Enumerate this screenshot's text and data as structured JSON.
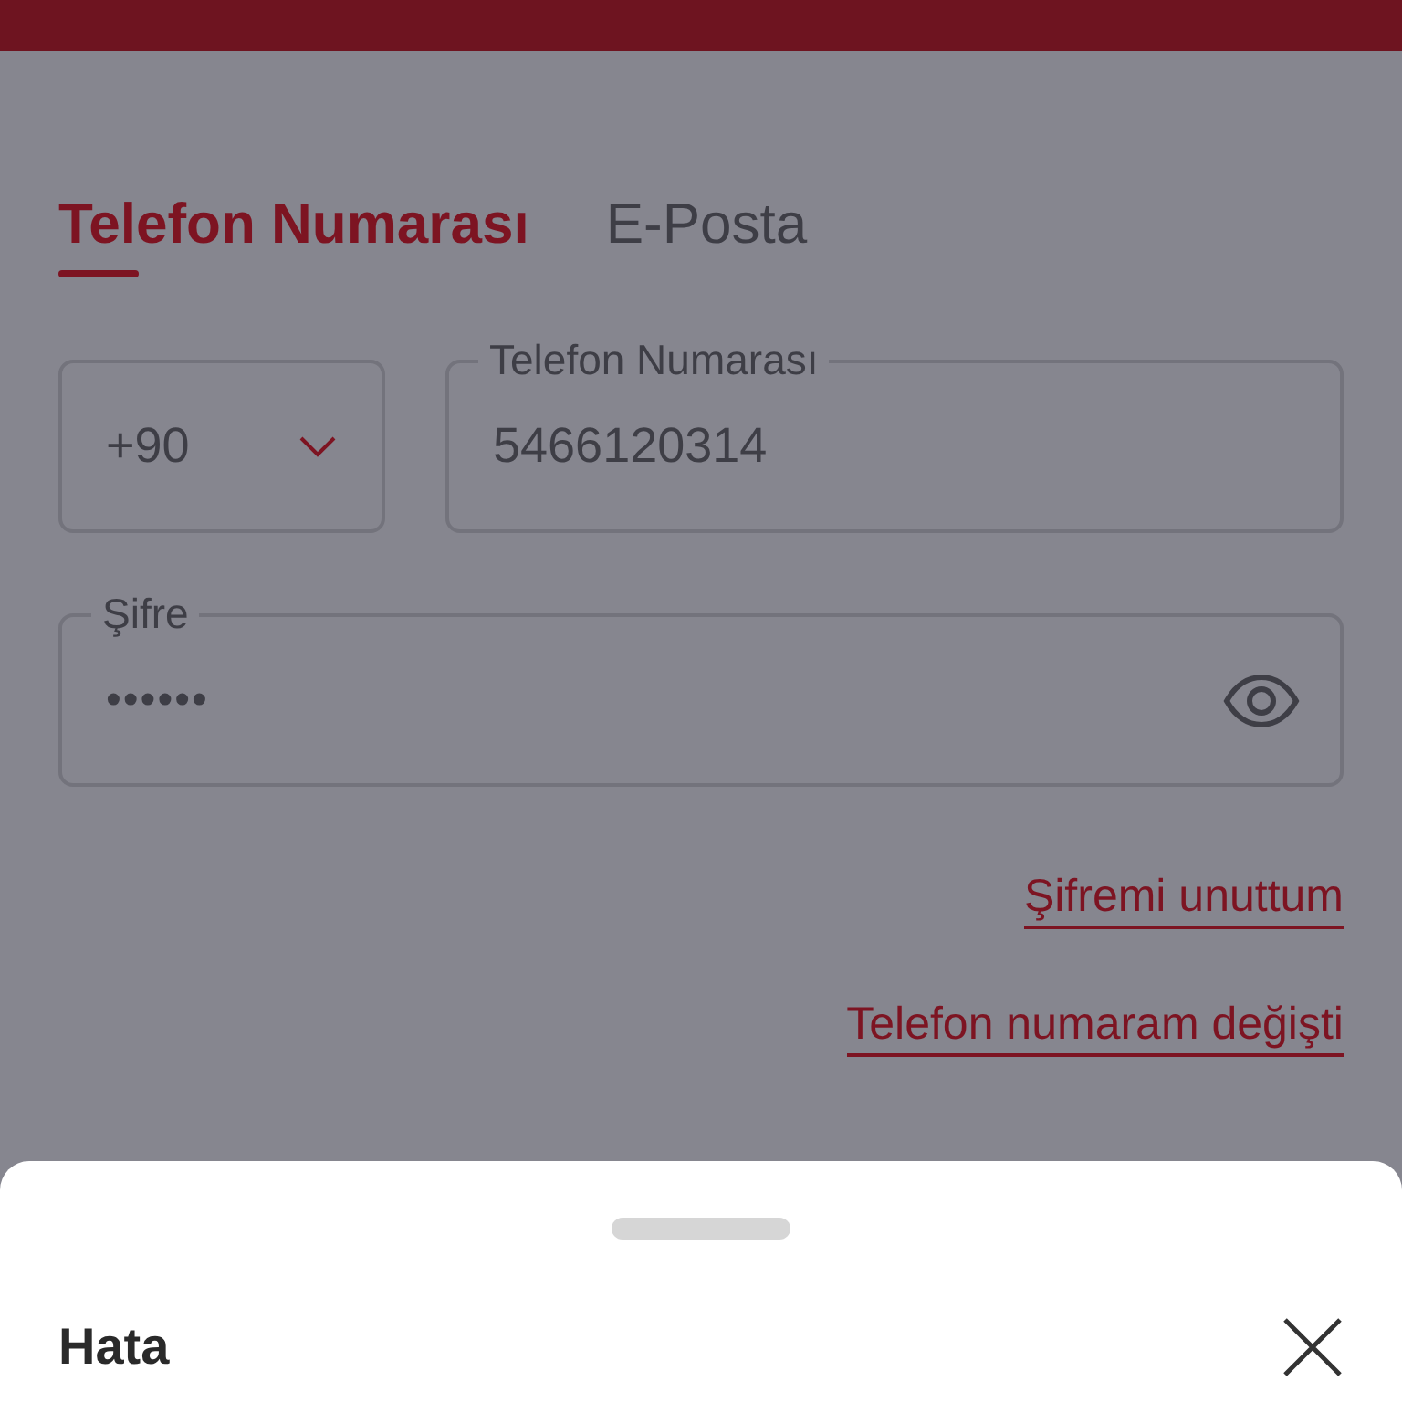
{
  "tabs": [
    {
      "label": "Telefon Numarası",
      "selected": true
    },
    {
      "label": "E-Posta",
      "selected": false
    }
  ],
  "country_code": {
    "value": "+90"
  },
  "phone": {
    "label": "Telefon Numarası",
    "value": "5466120314"
  },
  "password": {
    "label": "Şifre",
    "value": "••••••"
  },
  "links": [
    "Şifremi unuttum",
    "Telefon numaram değişti"
  ],
  "sheet": {
    "title": "Hata"
  }
}
